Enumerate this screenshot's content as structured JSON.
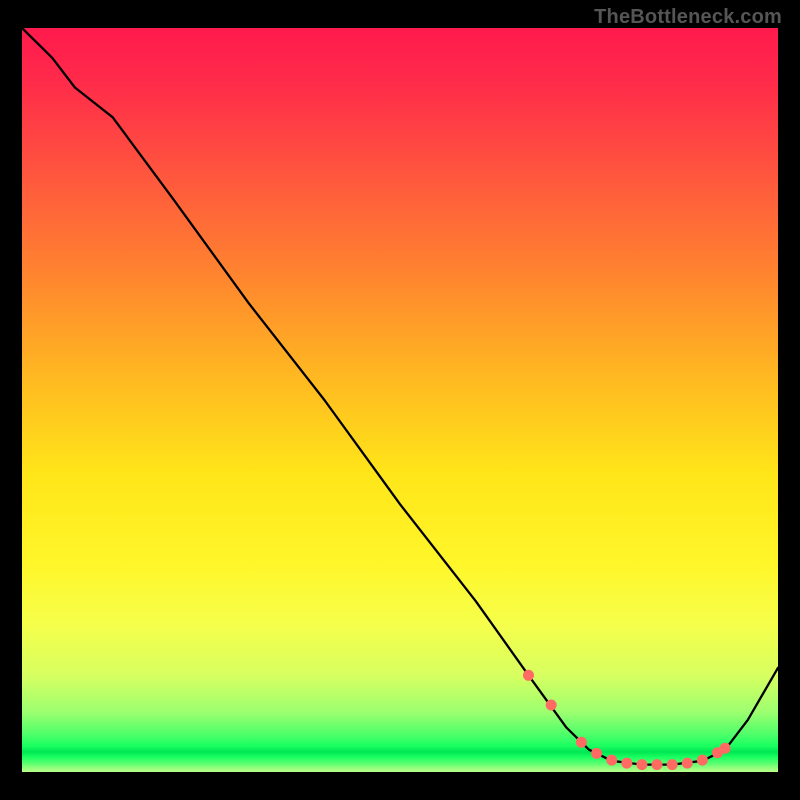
{
  "watermark": "TheBottleneck.com",
  "chart_data": {
    "type": "line",
    "title": "",
    "xlabel": "",
    "ylabel": "",
    "xlim": [
      0,
      100
    ],
    "ylim": [
      0,
      100
    ],
    "series": [
      {
        "name": "curve",
        "x": [
          0,
          4,
          7,
          12,
          20,
          30,
          40,
          50,
          60,
          67,
          72,
          75,
          78,
          82,
          86,
          90,
          93,
          96,
          100
        ],
        "y": [
          100,
          96,
          92,
          88,
          77,
          63,
          50,
          36,
          23,
          13,
          6,
          3,
          1.5,
          1,
          1,
          1.5,
          3,
          7,
          14
        ]
      }
    ],
    "markers": {
      "name": "highlight-points",
      "color": "#ff6b63",
      "x": [
        67,
        70,
        74,
        76,
        78,
        80,
        82,
        84,
        86,
        88,
        90,
        92,
        93
      ],
      "y": [
        13,
        9,
        4,
        2.5,
        1.6,
        1.2,
        1,
        1,
        1,
        1.2,
        1.6,
        2.6,
        3.2
      ]
    },
    "gradient_stops": [
      {
        "pos": 0.0,
        "color": "#ff1a4d"
      },
      {
        "pos": 0.32,
        "color": "#ff8030"
      },
      {
        "pos": 0.6,
        "color": "#ffe619"
      },
      {
        "pos": 0.88,
        "color": "#d7ff60"
      },
      {
        "pos": 0.965,
        "color": "#1aff60"
      },
      {
        "pos": 1.0,
        "color": "#b9ff88"
      }
    ]
  }
}
